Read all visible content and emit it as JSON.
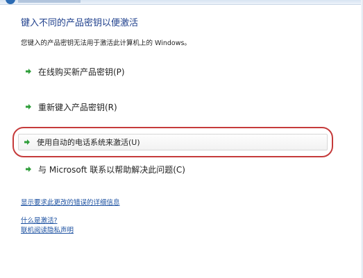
{
  "heading": "键入不同的产品密钥以便激活",
  "description": "您键入的产品密钥无法用于激活此计算机上的 Windows。",
  "options": [
    {
      "label": "在线购买新产品密钥(P)",
      "icon": "green-arrow-icon"
    },
    {
      "label": "重新键入产品密钥(R)",
      "icon": "green-arrow-icon"
    },
    {
      "label": "使用自动的电话系统来激活(U)",
      "icon": "green-arrow-icon",
      "highlighted": true
    },
    {
      "label": "与 Microsoft 联系以帮助解决此问题(C)",
      "icon": "green-arrow-icon"
    }
  ],
  "links": {
    "details": "显示要求此更改的错误的详细信息",
    "what_is_activation": "什么是激活?",
    "privacy": "联机阅读隐私声明"
  },
  "colors": {
    "heading": "#1e3f8c",
    "link": "#1a4fa0",
    "arrow": "#2f9e3a",
    "highlight_border": "#c53a3a"
  }
}
